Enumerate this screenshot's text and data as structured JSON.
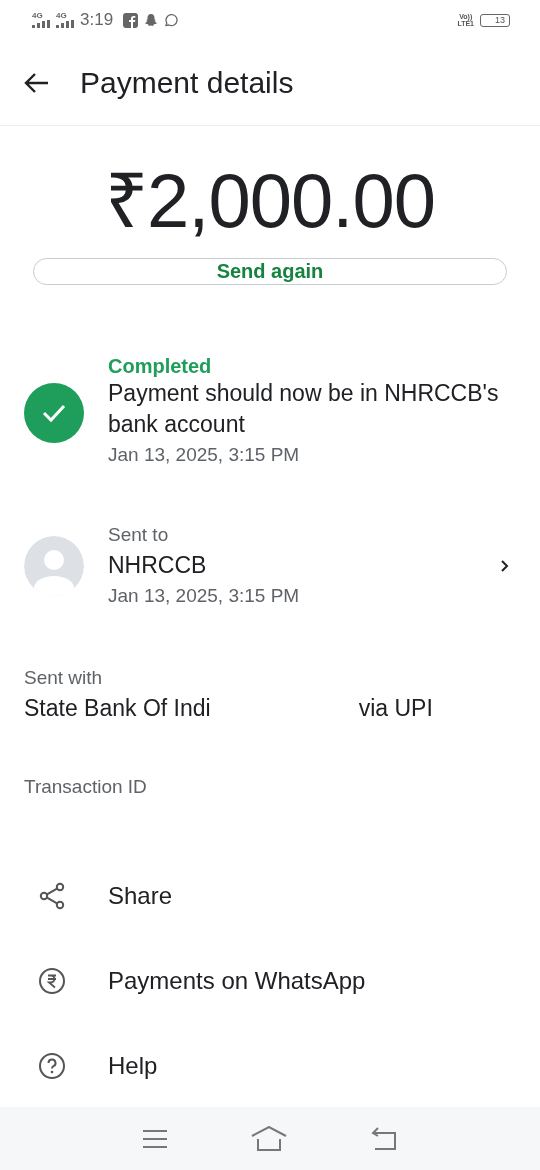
{
  "status_bar": {
    "time": "3:19",
    "sim_1": "4G",
    "sim_2": "4G",
    "volte": "Vo))\nLTE1",
    "battery": "13"
  },
  "header": {
    "title": "Payment details"
  },
  "amount": "₹2,000.00",
  "send_again": "Send again",
  "status": {
    "label": "Completed",
    "message": "Payment should now be in NHRCCB's bank account",
    "time": "Jan 13, 2025, 3:15 PM",
    "completed": true
  },
  "recipient": {
    "label": "Sent to",
    "name": "NHRCCB",
    "time": "Jan 13, 2025, 3:15 PM"
  },
  "sent_with": {
    "label": "Sent with",
    "bank": "State Bank Of Indi",
    "method": "via UPI"
  },
  "transaction": {
    "label": "Transaction ID"
  },
  "actions": [
    {
      "kind": "share",
      "label": "Share"
    },
    {
      "kind": "rupee",
      "label": "Payments on WhatsApp"
    },
    {
      "kind": "help",
      "label": "Help"
    }
  ]
}
